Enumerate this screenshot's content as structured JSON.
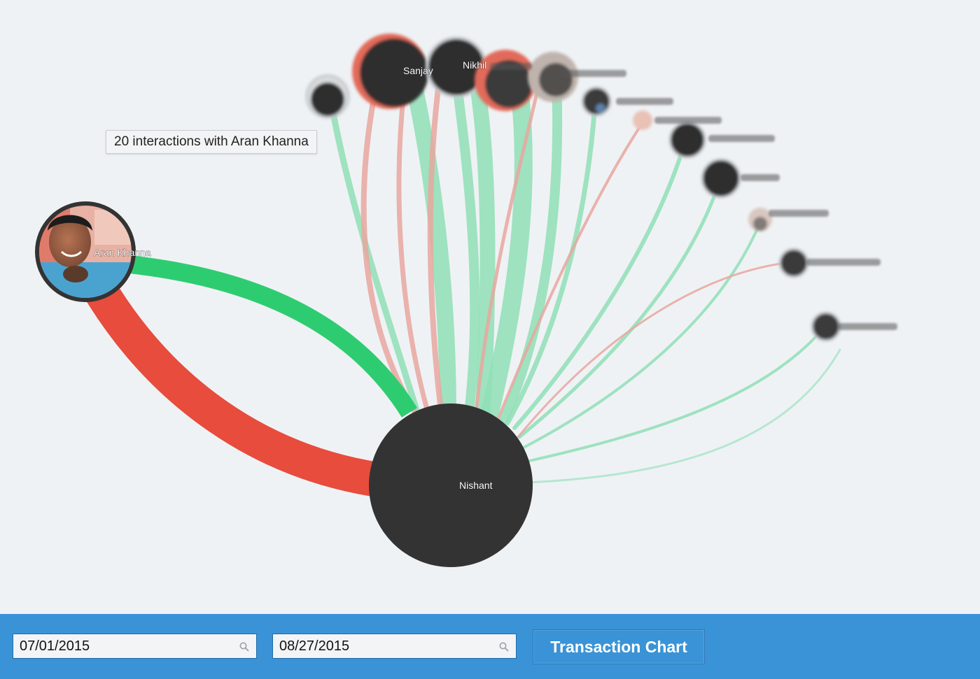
{
  "tooltip": {
    "text": "20 interactions with Aran Khanna"
  },
  "colors": {
    "positive": "#2ecc71",
    "negative": "#e74c3c",
    "node": "#333333",
    "background": "#eff2f5",
    "toolbar": "#3a93d6"
  },
  "center_node": {
    "label": "Nishant"
  },
  "highlighted_node": {
    "label": "Aran Khanna"
  },
  "nodes": [
    {
      "id": "sanjay",
      "label": "Sanjay"
    },
    {
      "id": "nikhil",
      "label": "Nikhil"
    }
  ],
  "toolbar": {
    "start_date": "07/01/2015",
    "end_date": "08/27/2015",
    "search_icon": "search-icon",
    "chart_button_label": "Transaction Chart"
  }
}
